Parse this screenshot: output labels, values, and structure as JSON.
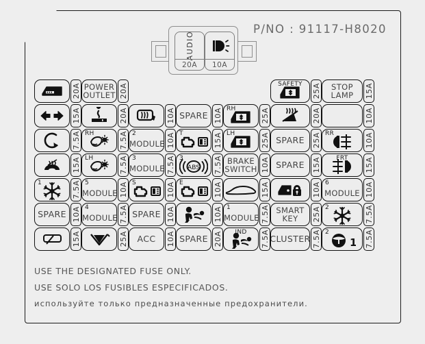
{
  "part_number": "P/NO : 91117-H8020",
  "module": {
    "fuses": [
      {
        "label": "AUDIO",
        "amp": "20A",
        "icon": "text"
      },
      {
        "label": "",
        "amp": "10A",
        "icon": "headlamp-icon"
      }
    ]
  },
  "columns": [
    {
      "index": 1,
      "fuses": [
        {
          "row": 1,
          "icon": "glovebox-icon",
          "text": "",
          "sup": "",
          "amp": "20A"
        },
        {
          "row": 2,
          "icon": "hazard-arrows-icon",
          "text": "",
          "sup": "",
          "amp": "15A"
        },
        {
          "row": 3,
          "icon": "horn-icon",
          "text": "",
          "sup": "",
          "amp": "7.5A"
        },
        {
          "row": 4,
          "icon": "seat-heater-icon",
          "text": "",
          "sup": "",
          "amp": "15A"
        },
        {
          "row": 5,
          "icon": "snowflake-icon",
          "text": "",
          "sup": "1",
          "amp": "7.5A"
        },
        {
          "row": 6,
          "icon": "text",
          "text": "SPARE",
          "sup": "",
          "amp": "10A"
        },
        {
          "row": 7,
          "icon": "rear-wiper-icon",
          "text": "",
          "sup": "",
          "amp": "15A"
        }
      ]
    },
    {
      "index": 2,
      "fuses": [
        {
          "row": 1,
          "icon": "text",
          "text": "POWER\nOUTLET",
          "sup": "",
          "amp": "20A"
        },
        {
          "row": 2,
          "icon": "cigar-lighter-icon",
          "text": "",
          "sup": "",
          "amp": "20A"
        },
        {
          "row": 3,
          "icon": "mirror-heater-icon",
          "text": "",
          "sup": "RH",
          "amp": "7.5A"
        },
        {
          "row": 4,
          "icon": "mirror-heater-icon",
          "text": "",
          "sup": "LH",
          "amp": "7.5A"
        },
        {
          "row": 5,
          "icon": "module-text",
          "text": "MODULE",
          "sup": "5",
          "amp": "10A"
        },
        {
          "row": 6,
          "icon": "module-text",
          "text": "MODULE",
          "sup": "4",
          "amp": "7.5A"
        },
        {
          "row": 7,
          "icon": "wiper-icon",
          "text": "",
          "sup": "",
          "amp": "25A"
        }
      ]
    },
    {
      "index": 3,
      "fuses": [
        {
          "row": 2,
          "icon": "rear-defogger-icon",
          "text": "",
          "sup": "",
          "amp": "10A"
        },
        {
          "row": 3,
          "icon": "module-text",
          "text": "MODULE",
          "sup": "2",
          "amp": "10A"
        },
        {
          "row": 4,
          "icon": "module-text",
          "text": "MODULE",
          "sup": "3",
          "amp": "7.5A"
        },
        {
          "row": 5,
          "icon": "engine-book-icon",
          "text": "",
          "sup": "S",
          "amp": "10A"
        },
        {
          "row": 6,
          "icon": "text",
          "text": "SPARE",
          "sup": "",
          "amp": "10A"
        },
        {
          "row": 7,
          "icon": "text",
          "text": "ACC",
          "sup": "",
          "amp": "10A"
        }
      ]
    },
    {
      "index": 4,
      "fuses": [
        {
          "row": 2,
          "icon": "text",
          "text": "SPARE",
          "sup": "",
          "amp": "10A"
        },
        {
          "row": 3,
          "icon": "engine-book-icon",
          "text": "",
          "sup": "T",
          "amp": "15A"
        },
        {
          "row": 4,
          "icon": "abs-icon",
          "text": "",
          "sup": "3",
          "amp": "7.5A"
        },
        {
          "row": 5,
          "icon": "engine-book-icon",
          "text": "",
          "sup": "E",
          "amp": "10A"
        },
        {
          "row": 6,
          "icon": "airbag-icon",
          "text": "",
          "sup": "",
          "amp": "10A"
        },
        {
          "row": 7,
          "icon": "text",
          "text": "SPARE",
          "sup": "",
          "amp": "20A"
        }
      ]
    },
    {
      "index": 5,
      "fuses": [
        {
          "row": 2,
          "icon": "power-window-icon",
          "text": "",
          "sup": "RH",
          "amp": "25A"
        },
        {
          "row": 3,
          "icon": "power-window-icon",
          "text": "",
          "sup": "LH",
          "amp": "25A"
        },
        {
          "row": 4,
          "icon": "text",
          "text": "BRAKE\nSWITCH",
          "sup": "",
          "amp": "10A"
        },
        {
          "row": 5,
          "icon": "car-body-icon",
          "text": "",
          "sup": "",
          "amp": "15A"
        },
        {
          "row": 6,
          "icon": "module-text",
          "text": "MODULE",
          "sup": "1",
          "amp": "7.5A"
        },
        {
          "row": 7,
          "icon": "airbag-icon",
          "text": "",
          "sup": "IND",
          "amp": "7.5A"
        }
      ]
    },
    {
      "index": 6,
      "fuses": [
        {
          "row": 1,
          "icon": "power-window-icon",
          "text": "",
          "sup": "SAFETY",
          "amp": "25A"
        },
        {
          "row": 2,
          "icon": "rear-seat-heater-icon",
          "text": "",
          "sup": "",
          "amp": "20A"
        },
        {
          "row": 3,
          "icon": "text",
          "text": "SPARE",
          "sup": "",
          "amp": "25A"
        },
        {
          "row": 4,
          "icon": "text",
          "text": "SPARE",
          "sup": "",
          "amp": "15A"
        },
        {
          "row": 5,
          "icon": "door-lock-icon",
          "text": "",
          "sup": "",
          "amp": "10A"
        },
        {
          "row": 6,
          "icon": "text",
          "text": "SMART\nKEY",
          "sup": "",
          "amp": "25A"
        },
        {
          "row": 7,
          "icon": "text",
          "text": "CLUSTER",
          "sup": "",
          "amp": "7.5A"
        }
      ]
    },
    {
      "index": 7,
      "fuses": [
        {
          "row": 1,
          "icon": "text",
          "text": "STOP\nLAMP",
          "sup": "",
          "amp": "15A"
        },
        {
          "row": 2,
          "icon": "headlamp-icon",
          "text": "",
          "sup": "",
          "amp": "10A"
        },
        {
          "row": 3,
          "icon": "rear-fog-icon",
          "text": "",
          "sup": "RR",
          "amp": "10A"
        },
        {
          "row": 4,
          "icon": "front-fog-icon",
          "text": "",
          "sup": "FRT",
          "amp": "15A"
        },
        {
          "row": 5,
          "icon": "module-text",
          "text": "MODULE",
          "sup": "6",
          "amp": "10A"
        },
        {
          "row": 6,
          "icon": "snowflake-icon",
          "text": "",
          "sup": "2",
          "amp": "7.5A"
        },
        {
          "row": 7,
          "icon": "steering-wheel-icon",
          "text": "",
          "sup": "2",
          "amp": "7.5A"
        }
      ]
    }
  ],
  "legend": {
    "line_en": "USE THE DESIGNATED FUSE ONLY.",
    "line_es": "USE SOLO LOS FUSIBLES ESPECIFICADOS.",
    "line_ru": "используйте только предназначенные предохранители."
  },
  "colors": {
    "background": "#eeeeee",
    "outline": "#111111",
    "text_gray": "#555555",
    "module_outline": "#8d8d8d"
  }
}
